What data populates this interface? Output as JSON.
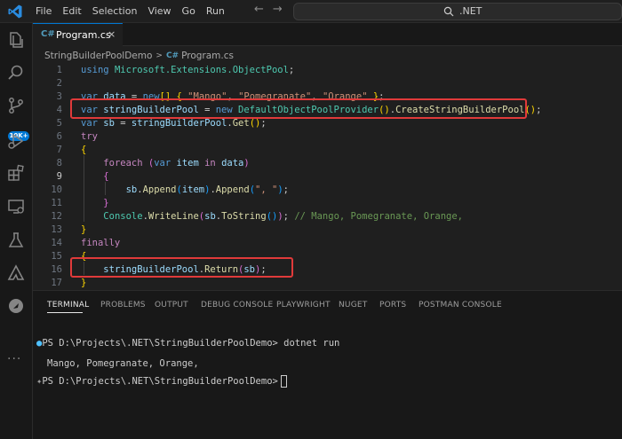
{
  "titlebar": {
    "menu": [
      "File",
      "Edit",
      "Selection",
      "View",
      "Go",
      "Run"
    ],
    "search_text": ".NET"
  },
  "activity": {
    "badge": "10K+",
    "more": "···"
  },
  "tab": {
    "icon_text": "C#",
    "label": "Program.cs",
    "close": "×"
  },
  "breadcrumb": {
    "project": "StringBuilderPoolDemo",
    "separator": ">",
    "icon_text": "C#",
    "file": "Program.cs"
  },
  "editor": {
    "active_line": 9,
    "lines": [
      {
        "n": 1,
        "tokens": [
          [
            "kw",
            "using "
          ],
          [
            "ty",
            "Microsoft.Extensions.ObjectPool"
          ],
          [
            "",
            "; "
          ]
        ]
      },
      {
        "n": 2,
        "tokens": []
      },
      {
        "n": 3,
        "tokens": [
          [
            "kw",
            "var "
          ],
          [
            "id",
            "data"
          ],
          [
            "",
            " = "
          ],
          [
            "kw",
            "new"
          ],
          [
            "br1",
            "[]"
          ],
          [
            "",
            " "
          ],
          [
            "br1",
            "{"
          ],
          [
            "",
            " "
          ],
          [
            "str",
            "\"Mango\""
          ],
          [
            "",
            ", "
          ],
          [
            "str",
            "\"Pomegranate\""
          ],
          [
            "",
            ", "
          ],
          [
            "str",
            "\"Orange\""
          ],
          [
            "",
            " "
          ],
          [
            "br1",
            "}"
          ],
          [
            "",
            ";"
          ]
        ]
      },
      {
        "n": 4,
        "tokens": [
          [
            "kw",
            "var "
          ],
          [
            "id",
            "stringBuilderPool"
          ],
          [
            "",
            " = "
          ],
          [
            "kw",
            "new "
          ],
          [
            "ty",
            "DefaultObjectPoolProvider"
          ],
          [
            "br1",
            "()"
          ],
          [
            "",
            "."
          ],
          [
            "fn",
            "CreateStringBuilderPool"
          ],
          [
            "br1",
            "()"
          ],
          [
            "",
            ";"
          ]
        ]
      },
      {
        "n": 5,
        "tokens": [
          [
            "kw",
            "var "
          ],
          [
            "id",
            "sb"
          ],
          [
            "",
            " = "
          ],
          [
            "id",
            "stringBuilderPool"
          ],
          [
            "",
            "."
          ],
          [
            "fn",
            "Get"
          ],
          [
            "br1",
            "()"
          ],
          [
            "",
            ";"
          ]
        ]
      },
      {
        "n": 6,
        "tokens": [
          [
            "ctl",
            "try"
          ]
        ]
      },
      {
        "n": 7,
        "tokens": [
          [
            "br1",
            "{"
          ]
        ]
      },
      {
        "n": 8,
        "tokens": [
          [
            "",
            "    "
          ],
          [
            "ctl",
            "foreach "
          ],
          [
            "br2",
            "("
          ],
          [
            "kw",
            "var "
          ],
          [
            "id",
            "item "
          ],
          [
            "ctl",
            "in "
          ],
          [
            "id",
            "data"
          ],
          [
            "br2",
            ")"
          ]
        ]
      },
      {
        "n": 9,
        "tokens": [
          [
            "",
            "    "
          ],
          [
            "br2",
            "{"
          ]
        ]
      },
      {
        "n": 10,
        "tokens": [
          [
            "",
            "        "
          ],
          [
            "id",
            "sb"
          ],
          [
            "",
            "."
          ],
          [
            "fn",
            "Append"
          ],
          [
            "br3",
            "("
          ],
          [
            "id",
            "item"
          ],
          [
            "br3",
            ")"
          ],
          [
            "",
            "."
          ],
          [
            "fn",
            "Append"
          ],
          [
            "br3",
            "("
          ],
          [
            "str",
            "\", \""
          ],
          [
            "br3",
            ")"
          ],
          [
            "",
            ";"
          ]
        ]
      },
      {
        "n": 11,
        "tokens": [
          [
            "",
            "    "
          ],
          [
            "br2",
            "}"
          ]
        ]
      },
      {
        "n": 12,
        "tokens": [
          [
            "",
            "    "
          ],
          [
            "ty",
            "Console"
          ],
          [
            "",
            "."
          ],
          [
            "fn",
            "WriteLine"
          ],
          [
            "br2",
            "("
          ],
          [
            "id",
            "sb"
          ],
          [
            "",
            "."
          ],
          [
            "fn",
            "ToString"
          ],
          [
            "br3",
            "()"
          ],
          [
            "br2",
            ")"
          ],
          [
            "",
            "; "
          ],
          [
            "com",
            "// Mango, Pomegranate, Orange,"
          ]
        ]
      },
      {
        "n": 13,
        "tokens": [
          [
            "br1",
            "}"
          ]
        ]
      },
      {
        "n": 14,
        "tokens": [
          [
            "ctl",
            "finally"
          ]
        ]
      },
      {
        "n": 15,
        "tokens": [
          [
            "br1",
            "{"
          ]
        ]
      },
      {
        "n": 16,
        "tokens": [
          [
            "",
            "    "
          ],
          [
            "id",
            "stringBuilderPool"
          ],
          [
            "",
            "."
          ],
          [
            "fn",
            "Return"
          ],
          [
            "br2",
            "("
          ],
          [
            "id",
            "sb"
          ],
          [
            "br2",
            ")"
          ],
          [
            "",
            ";"
          ]
        ]
      },
      {
        "n": 17,
        "tokens": [
          [
            "br1",
            "}"
          ]
        ]
      }
    ]
  },
  "panel": {
    "tabs": [
      "TERMINAL",
      "PROBLEMS",
      "OUTPUT",
      "DEBUG CONSOLE",
      "PLAYWRIGHT",
      "NUGET",
      "PORTS",
      "POSTMAN CONSOLE"
    ],
    "terminal": {
      "dot": "●",
      "line1_prompt": "PS D:\\Projects\\.NET\\StringBuilderPoolDemo>",
      "line1_cmd": " dotnet run",
      "output": "Mango, Pomegranate, Orange,",
      "line3_icon": "✦",
      "line3_prompt": "PS D:\\Projects\\.NET\\StringBuilderPoolDemo>"
    }
  },
  "colors": {
    "accent": "#0078d4",
    "highlight_box": "#e03a3a"
  }
}
